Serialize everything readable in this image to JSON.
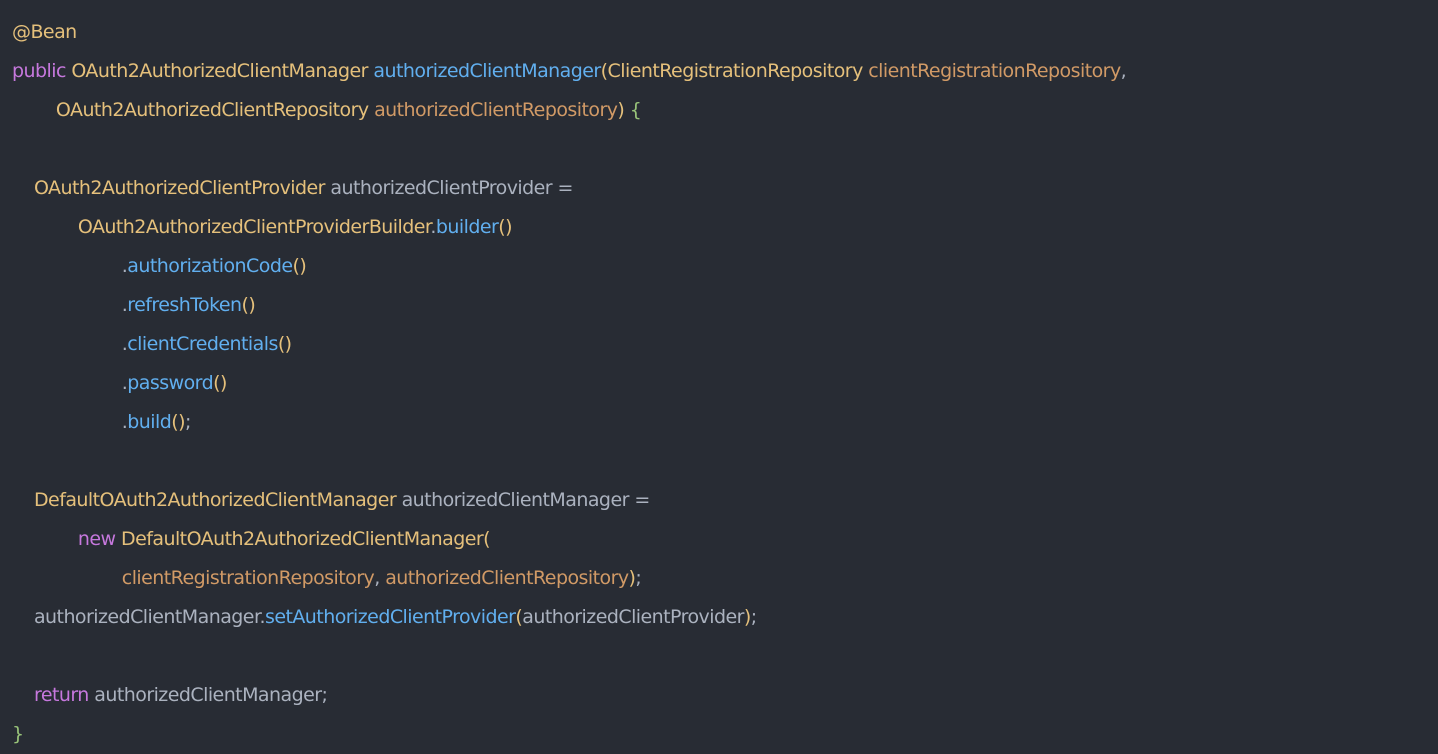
{
  "code": {
    "language": "java",
    "colors": {
      "background": "#282c34",
      "annotation": "#e5c07b",
      "keyword": "#c678dd",
      "type": "#e5c07b",
      "function": "#61afef",
      "parameter": "#d19a66",
      "plain": "#abb2bf",
      "paren": "#e5c07b",
      "brace": "#98c379"
    },
    "lines": [
      [
        {
          "k": "ann",
          "t": "@Bean"
        }
      ],
      [
        {
          "k": "kw",
          "t": "public "
        },
        {
          "k": "type",
          "t": "OAuth2AuthorizedClientManager "
        },
        {
          "k": "fn",
          "t": "authorizedClientManager"
        },
        {
          "k": "paren",
          "t": "("
        },
        {
          "k": "type",
          "t": "ClientRegistrationRepository "
        },
        {
          "k": "param",
          "t": "clientRegistrationRepository"
        },
        {
          "k": "plain",
          "t": ","
        }
      ],
      [
        {
          "k": "plain",
          "t": "        "
        },
        {
          "k": "type",
          "t": "OAuth2AuthorizedClientRepository "
        },
        {
          "k": "param",
          "t": "authorizedClientRepository"
        },
        {
          "k": "paren",
          "t": ")"
        },
        {
          "k": "plain",
          "t": " "
        },
        {
          "k": "brace",
          "t": "{"
        }
      ],
      [],
      [
        {
          "k": "plain",
          "t": "    "
        },
        {
          "k": "type",
          "t": "OAuth2AuthorizedClientProvider "
        },
        {
          "k": "plain",
          "t": "authorizedClientProvider ="
        }
      ],
      [
        {
          "k": "plain",
          "t": "            "
        },
        {
          "k": "type",
          "t": "OAuth2AuthorizedClientProviderBuilder"
        },
        {
          "k": "plain",
          "t": "."
        },
        {
          "k": "fn",
          "t": "builder"
        },
        {
          "k": "paren",
          "t": "()"
        }
      ],
      [
        {
          "k": "plain",
          "t": "                    ."
        },
        {
          "k": "fn",
          "t": "authorizationCode"
        },
        {
          "k": "paren",
          "t": "()"
        }
      ],
      [
        {
          "k": "plain",
          "t": "                    ."
        },
        {
          "k": "fn",
          "t": "refreshToken"
        },
        {
          "k": "paren",
          "t": "()"
        }
      ],
      [
        {
          "k": "plain",
          "t": "                    ."
        },
        {
          "k": "fn",
          "t": "clientCredentials"
        },
        {
          "k": "paren",
          "t": "()"
        }
      ],
      [
        {
          "k": "plain",
          "t": "                    ."
        },
        {
          "k": "fn",
          "t": "password"
        },
        {
          "k": "paren",
          "t": "()"
        }
      ],
      [
        {
          "k": "plain",
          "t": "                    ."
        },
        {
          "k": "fn",
          "t": "build"
        },
        {
          "k": "paren",
          "t": "()"
        },
        {
          "k": "plain",
          "t": ";"
        }
      ],
      [],
      [
        {
          "k": "plain",
          "t": "    "
        },
        {
          "k": "type",
          "t": "DefaultOAuth2AuthorizedClientManager "
        },
        {
          "k": "plain",
          "t": "authorizedClientManager ="
        }
      ],
      [
        {
          "k": "plain",
          "t": "            "
        },
        {
          "k": "kw",
          "t": "new "
        },
        {
          "k": "type",
          "t": "DefaultOAuth2AuthorizedClientManager"
        },
        {
          "k": "paren",
          "t": "("
        }
      ],
      [
        {
          "k": "plain",
          "t": "                    "
        },
        {
          "k": "param",
          "t": "clientRegistrationRepository"
        },
        {
          "k": "plain",
          "t": ", "
        },
        {
          "k": "param",
          "t": "authorizedClientRepository"
        },
        {
          "k": "paren",
          "t": ")"
        },
        {
          "k": "plain",
          "t": ";"
        }
      ],
      [
        {
          "k": "plain",
          "t": "    authorizedClientManager."
        },
        {
          "k": "fn",
          "t": "setAuthorizedClientProvider"
        },
        {
          "k": "paren",
          "t": "("
        },
        {
          "k": "plain",
          "t": "authorizedClientProvider"
        },
        {
          "k": "paren",
          "t": ")"
        },
        {
          "k": "plain",
          "t": ";"
        }
      ],
      [],
      [
        {
          "k": "plain",
          "t": "    "
        },
        {
          "k": "kw",
          "t": "return "
        },
        {
          "k": "plain",
          "t": "authorizedClientManager;"
        }
      ],
      [
        {
          "k": "brace",
          "t": "}"
        }
      ]
    ]
  }
}
